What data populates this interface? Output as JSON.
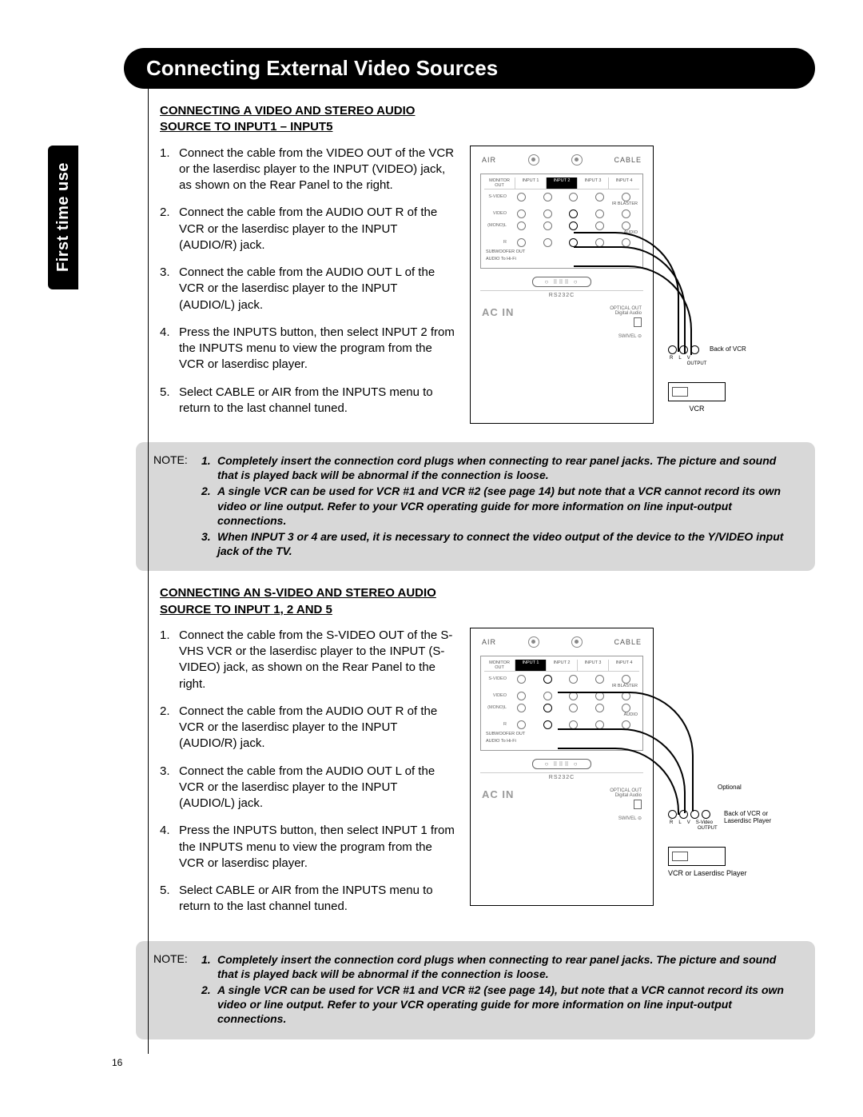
{
  "side_tab": "First time use",
  "title": "Connecting External Video Sources",
  "page_number": "16",
  "section1": {
    "heading_l1": "CONNECTING A VIDEO AND STEREO AUDIO",
    "heading_l2": "SOURCE TO INPUT1 – INPUT5",
    "steps": [
      "Connect the cable from the VIDEO OUT of the VCR or the laserdisc player to the INPUT (VIDEO) jack, as shown on the Rear Panel to the right.",
      "Connect the cable from the AUDIO OUT R of the VCR or the laserdisc player to the INPUT (AUDIO/R) jack.",
      "Connect the cable from the AUDIO OUT L of the VCR or the laserdisc player to the INPUT (AUDIO/L) jack.",
      "Press the INPUTS button, then select INPUT 2 from the INPUTS menu to view the program from the VCR or laserdisc player.",
      "Select CABLE or AIR from the INPUTS menu to return to the last channel tuned."
    ]
  },
  "note1": {
    "label": "NOTE:",
    "items": [
      "Completely insert the connection cord plugs when connecting to rear panel jacks. The picture and sound that is played back will be abnormal if the connection is loose.",
      "A single VCR can be used for VCR #1 and VCR #2 (see page 14) but note that a VCR cannot record its own video or line output. Refer to your VCR operating guide for more information on line input-output connections.",
      "When INPUT 3 or 4 are used, it is necessary to connect the video output of the device to the Y/VIDEO input jack of the TV."
    ]
  },
  "section2": {
    "heading_l1": "CONNECTING AN S-VIDEO AND STEREO AUDIO",
    "heading_l2": "SOURCE TO INPUT 1, 2 AND 5",
    "steps": [
      "Connect the cable from the S-VIDEO OUT of the S-VHS VCR or the laserdisc player to the INPUT (S-VIDEO) jack, as shown on the Rear Panel to the right.",
      "Connect the cable from the AUDIO OUT R of the VCR or the laserdisc player to the INPUT (AUDIO/R) jack.",
      "Connect the cable from the AUDIO OUT L of the VCR or the laserdisc player to the INPUT (AUDIO/L) jack.",
      "Press the INPUTS button, then select INPUT 1 from the INPUTS menu to view the program from the VCR or laserdisc player.",
      "Select CABLE or AIR from the INPUTS menu to return to the last channel tuned."
    ]
  },
  "note2": {
    "label": "NOTE:",
    "items": [
      "Completely insert the connection cord plugs when connecting to rear panel jacks. The picture and sound that is played back will be abnormal if the connection is loose.",
      "A single VCR can be used for VCR #1 and VCR #2 (see page 14), but note that a VCR cannot record its own video or line output. Refer to your VCR operating guide for more information on line input-output connections."
    ]
  },
  "diagram": {
    "air": "AIR",
    "cable": "CABLE",
    "hdr": [
      "MONITOR OUT",
      "INPUT 1",
      "INPUT 2",
      "INPUT 3",
      "INPUT 4"
    ],
    "rows": [
      "S-VIDEO",
      "VIDEO",
      "(MONO)L",
      "R"
    ],
    "ir": "IR BLASTER",
    "audio": "AUDIO",
    "sub": "SUBWOOFER OUT",
    "tohifi": "AUDIO To Hi-Fi",
    "rs232": "RS232C",
    "acin": "AC IN",
    "optical": "OPTICAL OUT",
    "optical2": "Digital Audio",
    "swivel": "SWIVEL",
    "plugs": [
      "R",
      "L",
      "V"
    ],
    "plugs2": [
      "R",
      "L",
      "V",
      "S-Video"
    ],
    "output": "OUTPUT",
    "back1": "Back of VCR",
    "dev1": "VCR",
    "back2": "Back of VCR or Laserdisc Player",
    "dev2": "VCR or Laserdisc Player",
    "optional": "Optional"
  }
}
